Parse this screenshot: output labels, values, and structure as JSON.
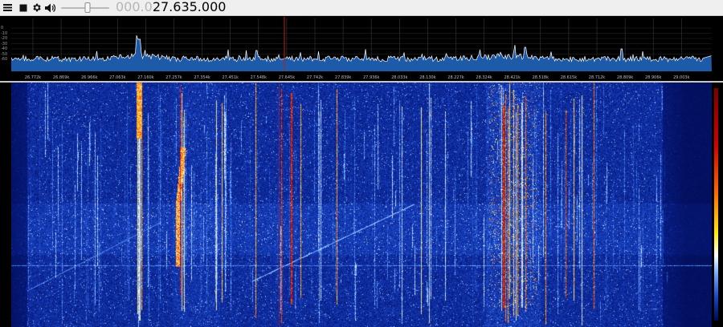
{
  "toolbar": {
    "menu_icon": "hamburger-menu-icon",
    "stop_icon": "stop-icon",
    "settings_icon": "gear-icon",
    "volume_icon": "speaker-icon",
    "volume_level": 0.55,
    "frequency_leading": "000.0",
    "frequency_main": "27.635.000"
  },
  "spectrum": {
    "y_ticks": [
      "0",
      "-10",
      "-20",
      "-30",
      "-40",
      "-50",
      "-60"
    ],
    "freq_labels": [
      "26.772k",
      "26.869k",
      "26.966k",
      "27.063k",
      "27.160k",
      "27.257k",
      "27.354k",
      "27.451k",
      "27.548k",
      "27.645k",
      "27.742k",
      "27.839k",
      "27.936k",
      "28.033k",
      "28.130k",
      "28.227k",
      "28.324k",
      "28.421k",
      "28.518k",
      "28.615k",
      "28.712k",
      "28.809k",
      "28.906k",
      "29.003k"
    ],
    "trace_color": "#ffffff",
    "fill_color": "#1f5fb0",
    "center_marker_color": "#c81a1a"
  },
  "waterfall": {
    "background_color": "#071a7a",
    "palette": [
      "#000a50",
      "#1546c8",
      "#6fa8ff",
      "#ffffff",
      "#ffe800",
      "#ff6a00",
      "#d40000"
    ]
  }
}
